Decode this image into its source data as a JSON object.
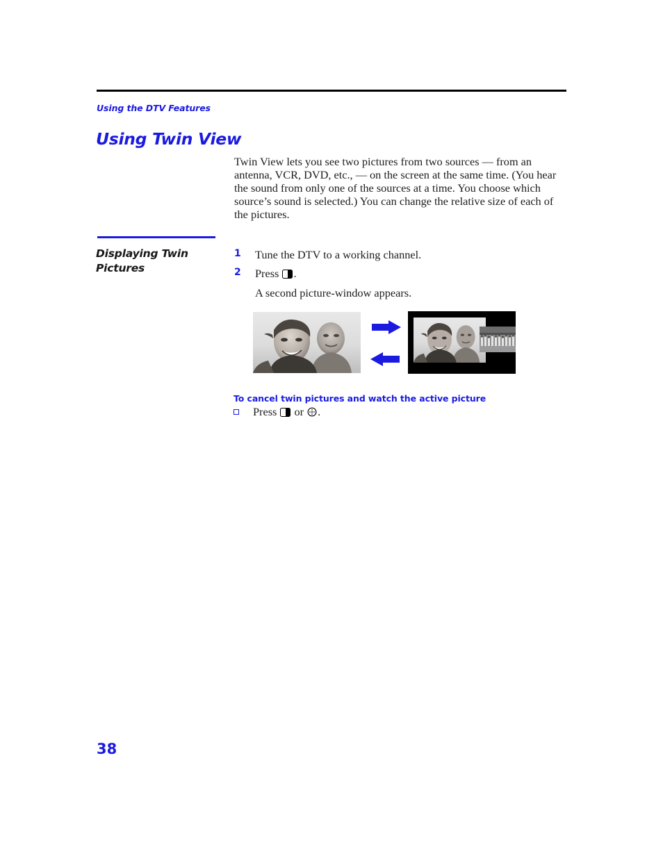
{
  "document": {
    "running_head": "Using the DTV Features",
    "chapter_title": "Using Twin View",
    "page_number": "38"
  },
  "intro": {
    "paragraph": "Twin View lets you see two pictures from two sources — from an antenna, VCR, DVD, etc., — on the screen at the same time. (You hear the sound from only one of the sources at a time. You choose which source’s sound is selected.) You can change the relative size of each of the pictures."
  },
  "section": {
    "heading": "Displaying Twin Pictures"
  },
  "steps": [
    {
      "number": "1",
      "text": "Tune the DTV to a working channel."
    },
    {
      "number": "2",
      "text_before_icon": "Press ",
      "icon": "twin-view-split-icon",
      "text_after_icon": ".",
      "note": "A second picture-window appears."
    }
  ],
  "figure": {
    "left_photo_alt": "Full-screen picture of two people smiling outdoors",
    "right_photo_alt": "Twin view: main picture window with a second smaller picture-window of a crowd",
    "arrow_right": "arrow-right-icon",
    "arrow_left": "arrow-left-icon",
    "arrow_color": "#1a1ae0"
  },
  "cancel": {
    "heading": "To cancel twin pictures and watch the active picture",
    "bullet": "hollow-square-bullet",
    "text_before_first_icon": "Press ",
    "first_icon": "twin-view-split-icon",
    "text_between_icons": " or ",
    "second_icon": "jump-circle-icon",
    "text_after_icons": "."
  },
  "colors": {
    "accent_blue": "#1a1ae0",
    "rule_black": "#000000",
    "body_text": "#1c1c1c"
  }
}
